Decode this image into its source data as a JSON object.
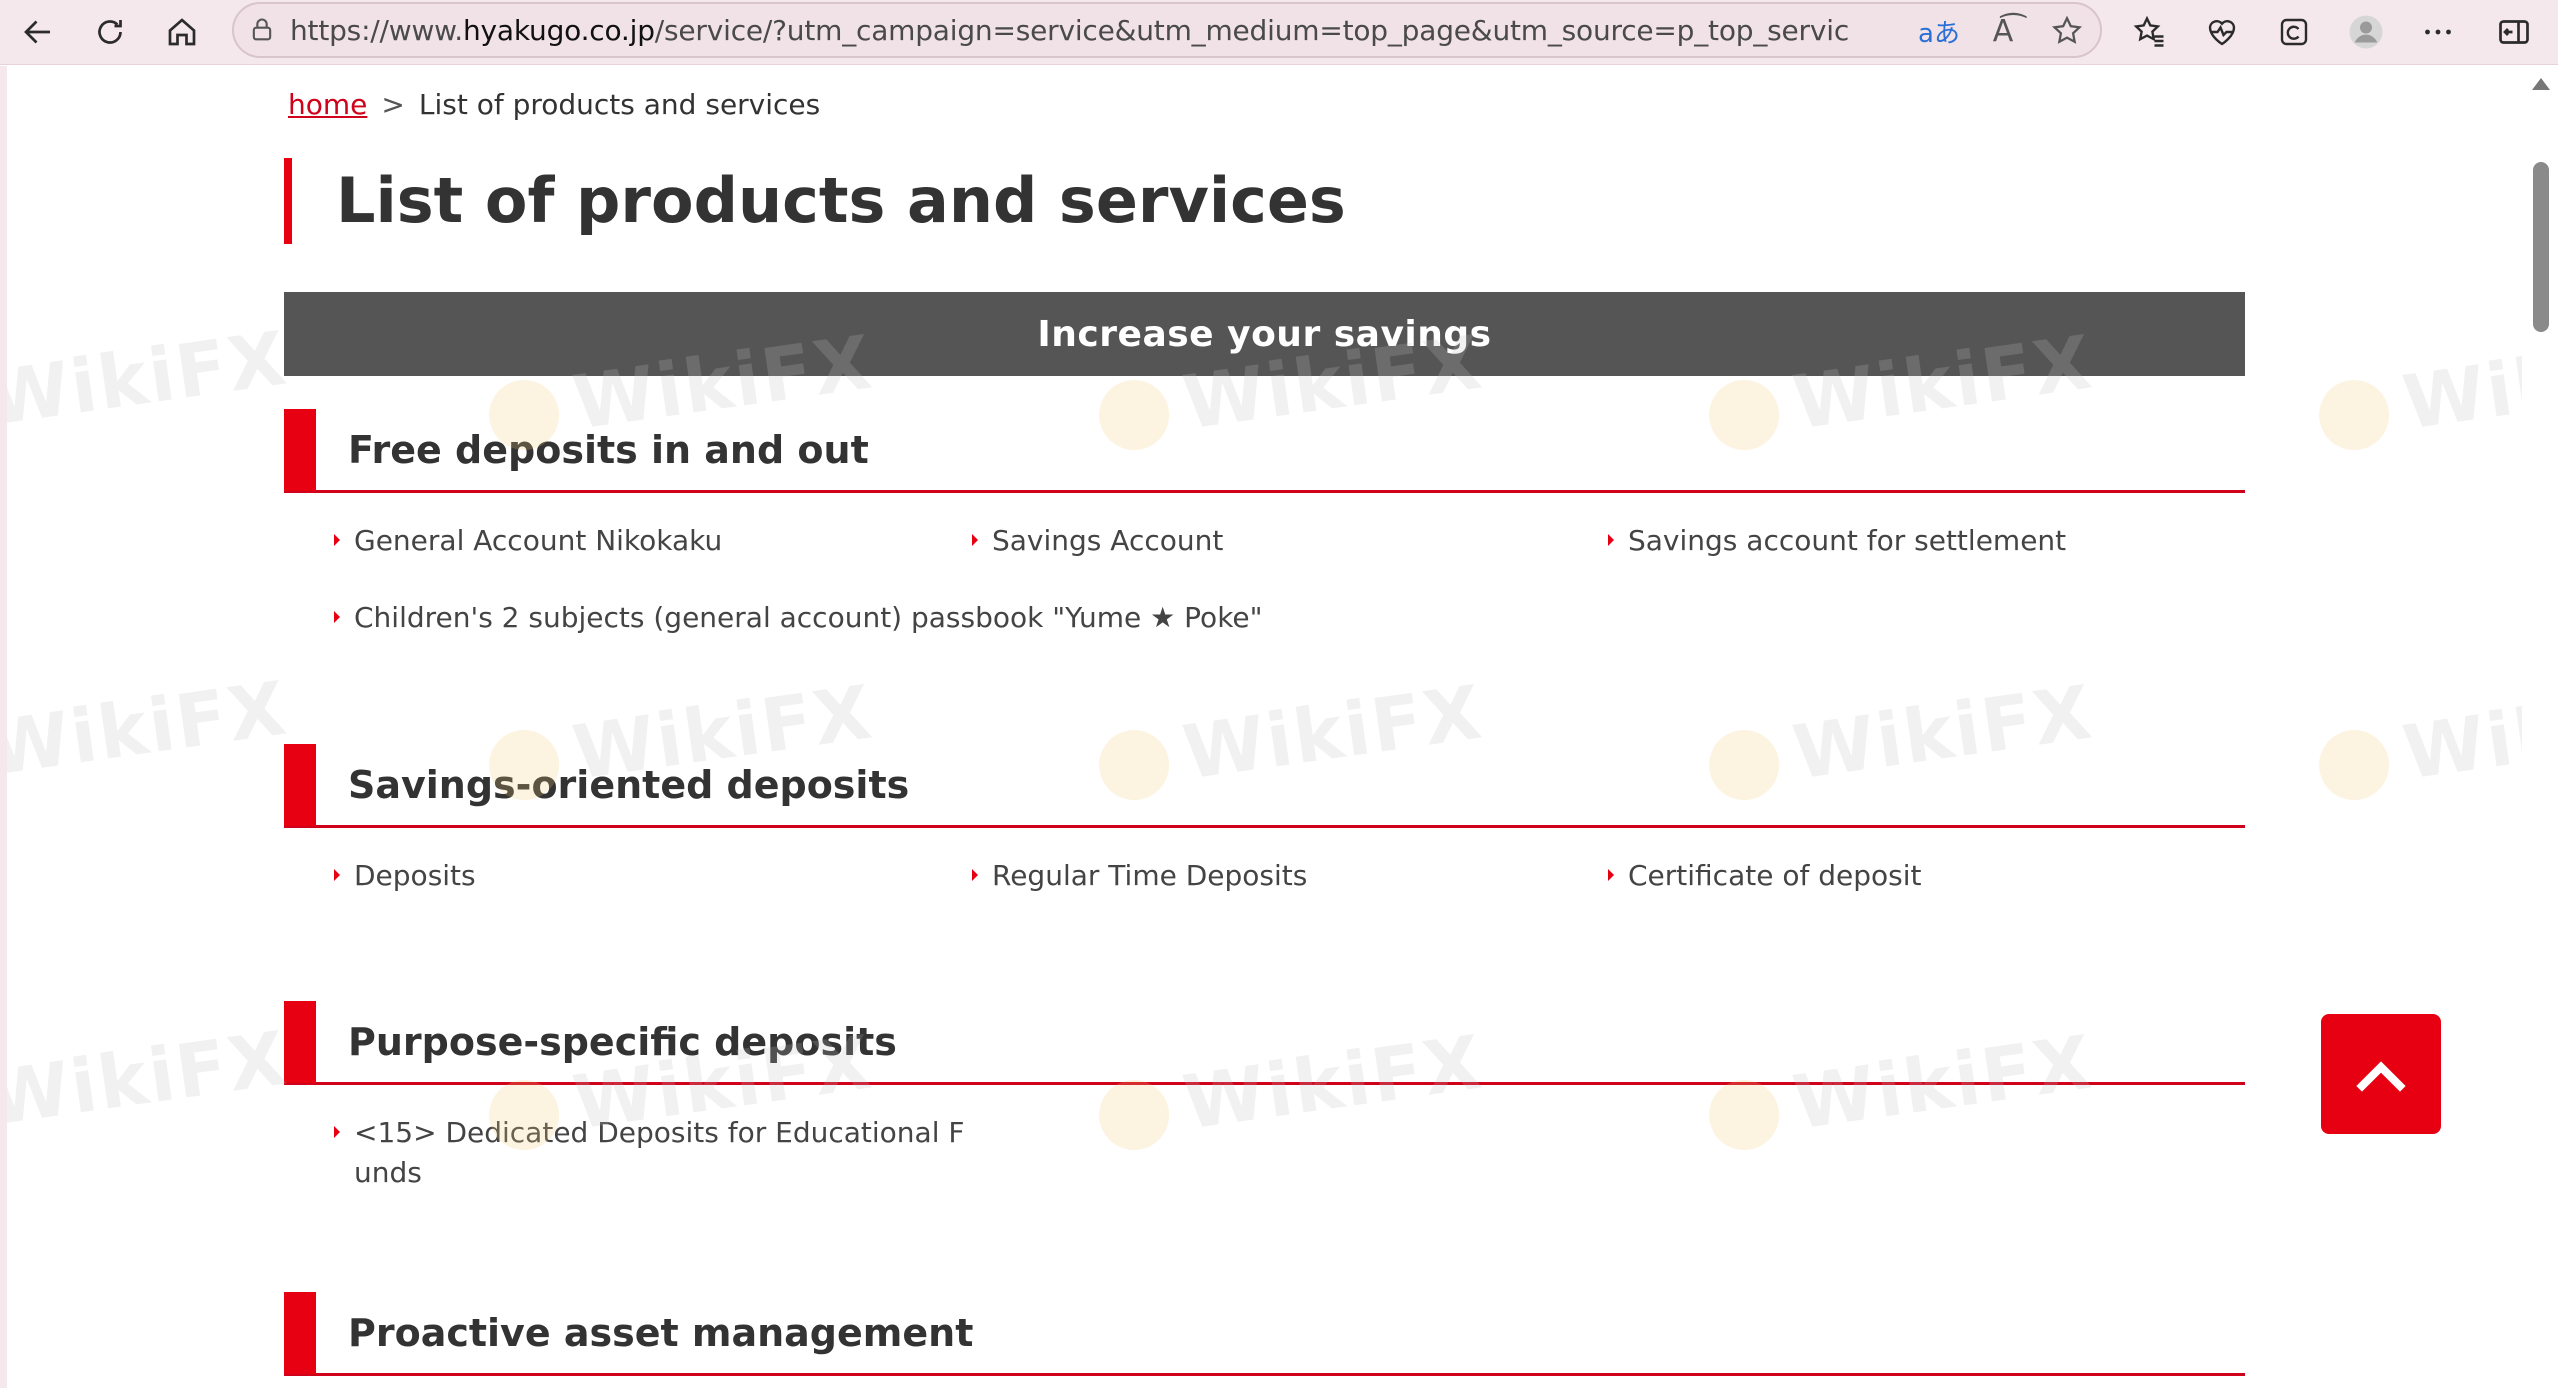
{
  "browser": {
    "url_prefix": "https://www.",
    "url_host": "hyakugo.co.jp",
    "url_rest": "/service/?utm_campaign=service&utm_medium=top_page&utm_source=p_top_service_popup",
    "icons": [
      "back-icon",
      "refresh-icon",
      "home-icon",
      "lock-icon",
      "translate-icon",
      "read-aloud-icon",
      "favorite-star-icon",
      "favorites-icon",
      "health-icon",
      "collections-icon",
      "profile-icon",
      "more-icon",
      "sidebar-icon"
    ],
    "translate_glyph": "aあ",
    "read_aloud_glyph": "A͡"
  },
  "breadcrumb": {
    "home_label": "home",
    "separator": ">",
    "current": "List of products and services"
  },
  "page": {
    "title": "List of products and services",
    "banner": "Increase your savings"
  },
  "sections": [
    {
      "heading": "Free deposits in and out",
      "items": [
        "General Account Nikokaku",
        "Savings Account",
        "Savings account for settlement",
        "Children's 2 subjects (general account) passbook \"Yume ★ Poke\""
      ]
    },
    {
      "heading": "Savings-oriented deposits",
      "items": [
        "Deposits",
        "Regular Time Deposits",
        "Certificate of deposit"
      ]
    },
    {
      "heading": "Purpose-specific deposits",
      "items": [
        "<15> Dedicated Deposits for Educational F",
        "unds"
      ]
    },
    {
      "heading": "Proactive asset management",
      "items": []
    }
  ],
  "watermark": "WikiFX",
  "colors": {
    "accent": "#e60012",
    "banner": "#555555",
    "chrome": "#f5e8ec"
  }
}
